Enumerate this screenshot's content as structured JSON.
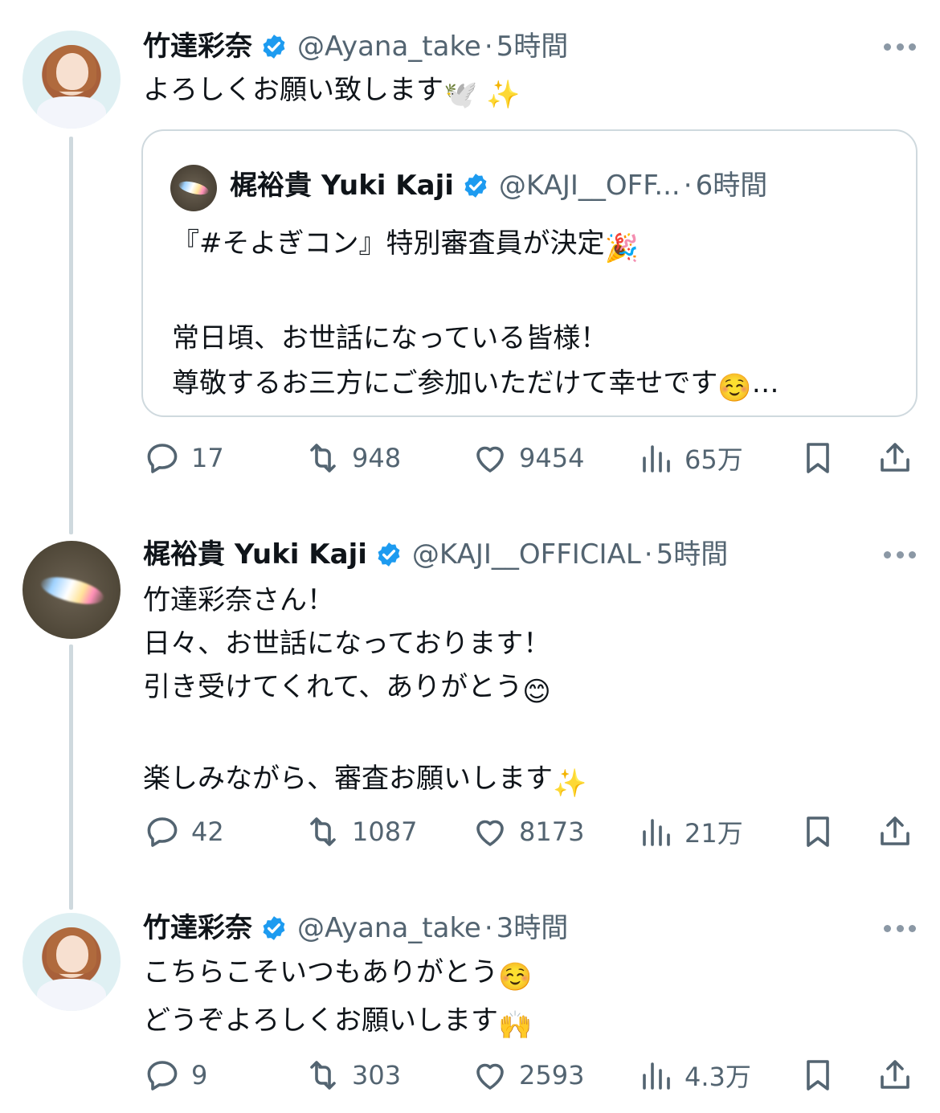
{
  "colors": {
    "accent": "#1d9bf0",
    "muted": "#536471",
    "line": "#cfd9de",
    "text": "#0f1419"
  },
  "tweets": [
    {
      "name": "竹達彩奈",
      "handle": "@Ayana_take",
      "dot": "·",
      "time": "5時間",
      "text": "よろしくお願い致します",
      "emojis": [
        "🕊️",
        "✨"
      ],
      "avatar_icon": "avatar-icon",
      "quote": {
        "name": "梶裕貴 Yuki Kaji",
        "handle": "@KAJI__OFF...",
        "dot": "·",
        "time": "6時間",
        "line1": "『#そよぎコン』特別審査員が決定",
        "line1_emoji": "🎉",
        "line2": "常日頃、お世話になっている皆様！",
        "line3": "尊敬するお三方にご参加いただけて幸せです",
        "line3_emoji": "☺️",
        "ellipsis": "…"
      },
      "stats": {
        "replies": "17",
        "reposts": "948",
        "likes": "9454",
        "views": "65万"
      }
    },
    {
      "name": "梶裕貴 Yuki Kaji",
      "handle": "@KAJI__OFFICIAL",
      "dot": "·",
      "time": "5時間",
      "lines": [
        "竹達彩奈さん！",
        "日々、お世話になっております！",
        "引き受けてくれて、ありがとう",
        "",
        "楽しみながら、審査お願いします"
      ],
      "line3_emoji": "😊",
      "line5_emoji": "✨",
      "stats": {
        "replies": "42",
        "reposts": "1087",
        "likes": "8173",
        "views": "21万"
      }
    },
    {
      "name": "竹達彩奈",
      "handle": "@Ayana_take",
      "dot": "·",
      "time": "3時間",
      "lines": [
        "こちらこそいつもありがとう",
        "どうぞよろしくお願いします"
      ],
      "line1_emoji": "☺️",
      "line2_emoji": "🙌",
      "stats": {
        "replies": "9",
        "reposts": "303",
        "likes": "2593",
        "views": "4.3万"
      }
    }
  ]
}
